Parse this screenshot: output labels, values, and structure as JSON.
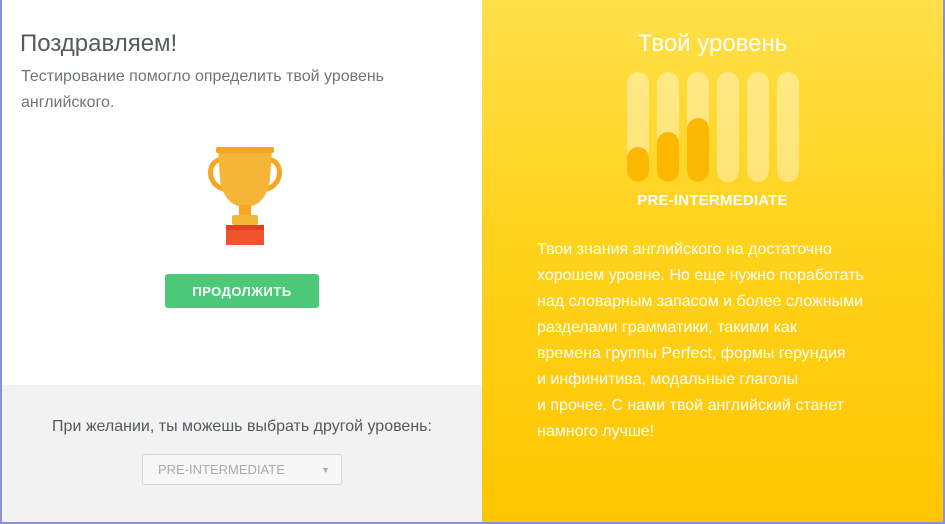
{
  "left": {
    "title": "Поздравляем!",
    "subtitle_line1": "Тестирование помогло определить твой уровень",
    "subtitle_line2": "английского.",
    "trophy_icon": "trophy-icon",
    "continue_label": "ПРОДОЛЖИТЬ",
    "continue_color": "#4bc878",
    "choose_label": "При желании, ты можешь выбрать другой уровень:",
    "level_select": {
      "selected": "PRE-INTERMEDIATE",
      "caret_icon": "chevron-down-icon"
    }
  },
  "right": {
    "title": "Твой уровень",
    "level_name": "PRE-INTERMEDIATE",
    "level_meter": {
      "total_levels": 6,
      "fill_fractions": [
        0.32,
        0.45,
        0.58,
        0,
        0,
        0
      ],
      "fill_color": "#fcb800"
    },
    "description_lines": [
      "Твои знания английского на достаточно",
      "хорошем уровне. Но еще нужно поработать",
      "над словарным запасом и более сложными",
      "разделами грамматики, такими как",
      "времена группы Perfect, формы герундия",
      "и инфинитива, модальные глаголы",
      "и прочее. С нами твой английский станет",
      "намного лучше!"
    ],
    "background_color": "#ffd21c"
  }
}
